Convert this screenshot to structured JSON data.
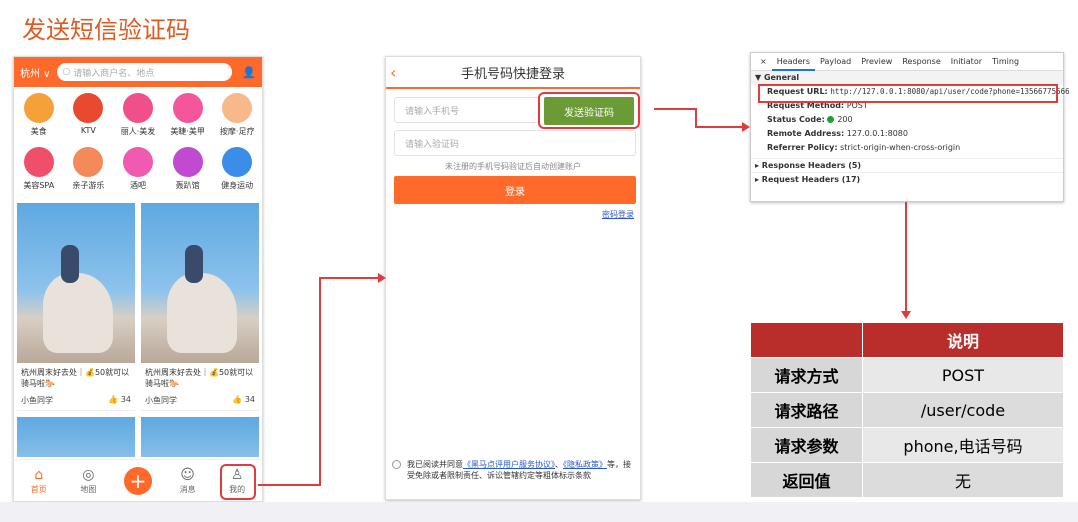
{
  "slide_title": "发送短信验证码",
  "colors": {
    "accent": "#ff6a2a",
    "green": "#6b9b34",
    "red": "#e23b3b",
    "table_header": "#b92e2b"
  },
  "home": {
    "city": "杭州 ∨",
    "search_placeholder": "请输入商户名、地点",
    "categories": [
      "美食",
      "KTV",
      "丽人·美发",
      "美睫·美甲",
      "按摩·足疗",
      "美容SPA",
      "亲子游乐",
      "酒吧",
      "轰趴馆",
      "健身运动"
    ],
    "cards": [
      {
        "text": "杭州周末好去处｜💰50就可以骑马啦🐎",
        "author": "小鱼同学",
        "likes": "34"
      },
      {
        "text": "杭州周末好去处｜💰50就可以骑马啦🐎",
        "author": "小鱼同学",
        "likes": "34"
      }
    ],
    "tabs": [
      "首页",
      "地图",
      "+",
      "消息",
      "我的"
    ]
  },
  "login": {
    "title": "手机号码快捷登录",
    "phone_placeholder": "请输入手机号",
    "send_code": "发送验证码",
    "code_placeholder": "请输入验证码",
    "hint": "未注册的手机号码验证后自动创建账户",
    "login_btn": "登录",
    "pwd_login": "密码登录",
    "agree_prefix": "我已阅读并同意",
    "agree_link1": "《黑马点评用户服务协议》",
    "agree_sep": "、",
    "agree_link2": "《隐私政策》",
    "agree_suffix": "等，接受免除或者限制责任、诉讼管辖约定等粗体标示条款"
  },
  "devtools": {
    "tabs": [
      "×",
      "Headers",
      "Payload",
      "Preview",
      "Response",
      "Initiator",
      "Timing"
    ],
    "general": "▼ General",
    "request_url_label": "Request URL:",
    "request_url": "http://127.0.0.1:8080/api/user/code?phone=13566775566",
    "method_label": "Request Method:",
    "method": "POST",
    "status_label": "Status Code:",
    "status": "200",
    "remote_label": "Remote Address:",
    "remote": "127.0.0.1:8080",
    "referrer_label": "Referrer Policy:",
    "referrer": "strict-origin-when-cross-origin",
    "response_headers": "▸ Response Headers (5)",
    "request_headers": "▸ Request Headers (17)"
  },
  "api_table": {
    "header": [
      "",
      "说明"
    ],
    "rows": [
      [
        "请求方式",
        "POST"
      ],
      [
        "请求路径",
        "/user/code"
      ],
      [
        "请求参数",
        "phone,电话号码"
      ],
      [
        "返回值",
        "无"
      ]
    ]
  }
}
